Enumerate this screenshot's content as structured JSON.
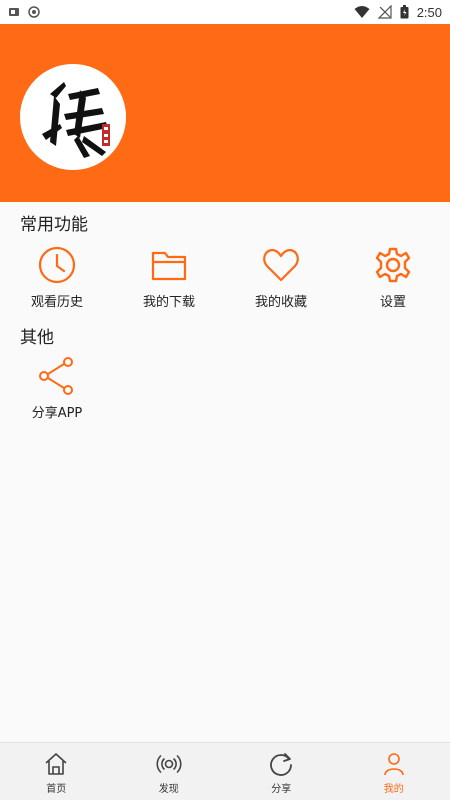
{
  "status_bar": {
    "time": "2:50"
  },
  "colors": {
    "accent": "#ff6a14",
    "background": "#fafafa"
  },
  "sections": {
    "common": {
      "title": "常用功能",
      "items": [
        {
          "label": "观看历史",
          "icon": "clock-icon"
        },
        {
          "label": "我的下载",
          "icon": "folder-icon"
        },
        {
          "label": "我的收藏",
          "icon": "heart-icon"
        },
        {
          "label": "设置",
          "icon": "gear-icon"
        }
      ]
    },
    "other": {
      "title": "其他",
      "items": [
        {
          "label": "分享APP",
          "icon": "share-icon"
        }
      ]
    }
  },
  "tabbar": {
    "tabs": [
      {
        "label": "首页",
        "icon": "home-icon",
        "active": false
      },
      {
        "label": "发现",
        "icon": "broadcast-icon",
        "active": false
      },
      {
        "label": "分享",
        "icon": "refresh-icon",
        "active": false
      },
      {
        "label": "我的",
        "icon": "user-icon",
        "active": true
      }
    ]
  }
}
